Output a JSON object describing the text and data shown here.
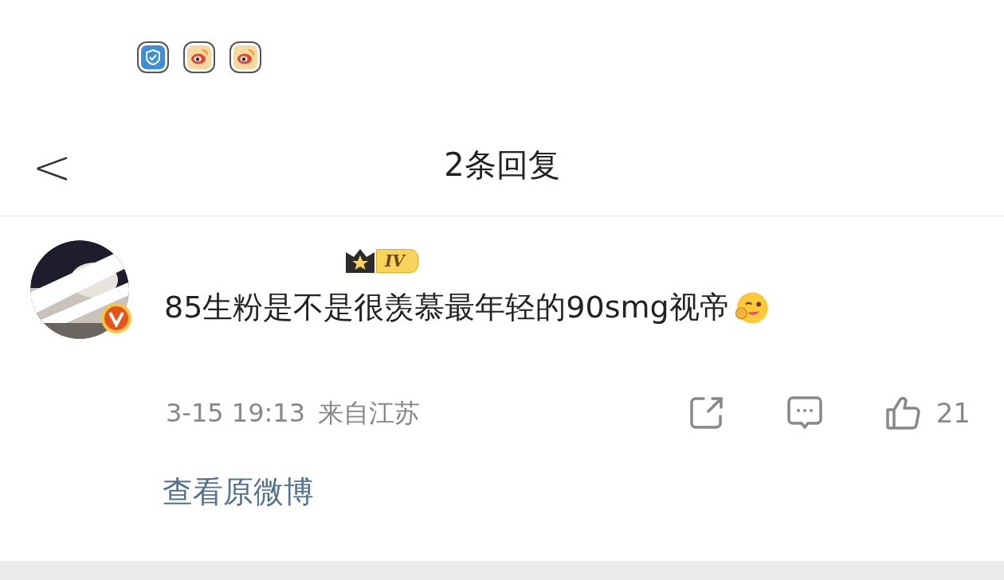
{
  "status_icons": [
    {
      "kind": "shield"
    },
    {
      "kind": "weibo"
    },
    {
      "kind": "weibo"
    }
  ],
  "header": {
    "back": "<",
    "title": "2条回复"
  },
  "comment": {
    "level_badge": "IV",
    "text": "85生粉是不是很羡慕最年轻的90smg视帝",
    "time": "3-15 19:13",
    "location": "来自江苏",
    "likes": "21"
  },
  "link": "查看原微博"
}
